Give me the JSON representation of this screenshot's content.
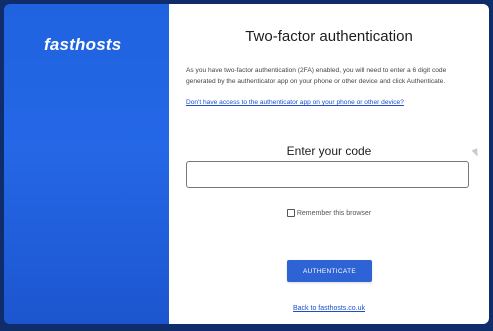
{
  "brand": {
    "logo_text": "fasthosts",
    "color": "#2567e6"
  },
  "auth": {
    "title": "Two-factor authentication",
    "description": "As you have two-factor authentication (2FA) enabled, you will need to enter a 6 digit code generated by the authenticator app on your phone or other device and click Authenticate.",
    "help_link": "Don't have access to the authenticator app on your phone or other device?",
    "code_label": "Enter your code",
    "code_value": "",
    "remember_label": "Remember this browser",
    "remember_checked": false,
    "submit_label": "AUTHENTICATE",
    "back_link": "Back to fasthosts.co.uk",
    "accent_color": "#2e63d6"
  }
}
